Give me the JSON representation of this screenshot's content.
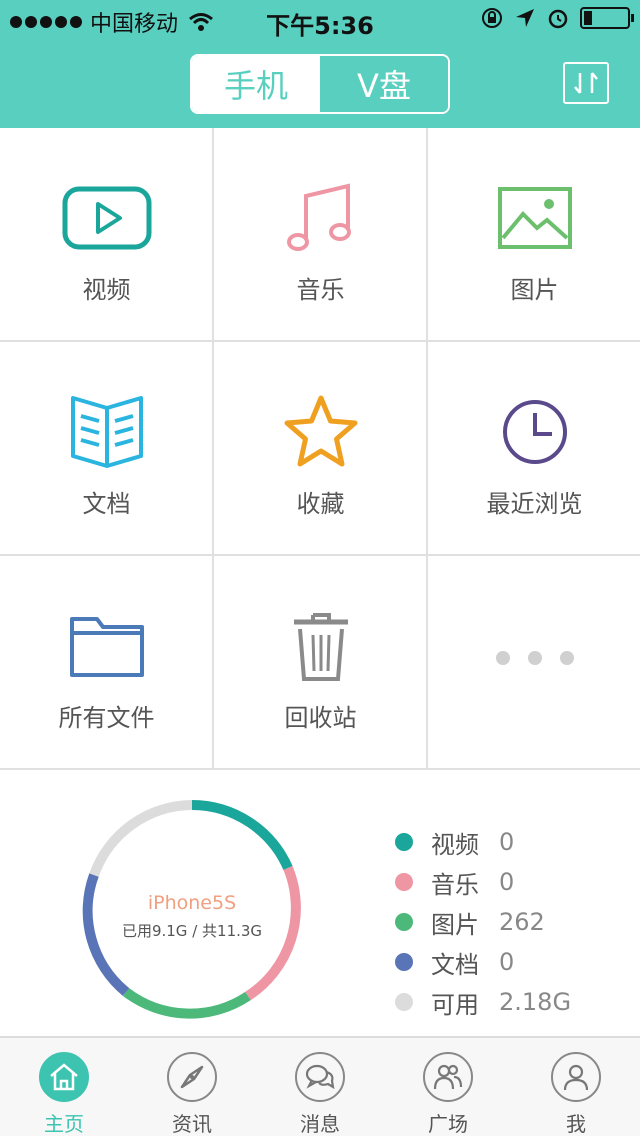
{
  "status_bar": {
    "carrier": "中国移动",
    "time": "下午5:36"
  },
  "header": {
    "segments": [
      "手机",
      "V盘"
    ],
    "active_segment": "手机",
    "transfer_icon": "transfer-icon"
  },
  "grid": {
    "items": [
      {
        "label": "视频",
        "icon": "video-icon",
        "color": "#1aa69a"
      },
      {
        "label": "音乐",
        "icon": "music-icon",
        "color": "#ef96a4"
      },
      {
        "label": "图片",
        "icon": "image-icon",
        "color": "#6cbf6c"
      },
      {
        "label": "文档",
        "icon": "document-icon",
        "color": "#2ab4e0"
      },
      {
        "label": "收藏",
        "icon": "star-icon",
        "color": "#f0a020"
      },
      {
        "label": "最近浏览",
        "icon": "clock-icon",
        "color": "#5a4a8c"
      },
      {
        "label": "所有文件",
        "icon": "folder-icon",
        "color": "#4a7ab8"
      },
      {
        "label": "回收站",
        "icon": "trash-icon",
        "color": "#8a8a8a"
      },
      {
        "label": "",
        "icon": "more-icon",
        "color": "#d0d0d0"
      }
    ]
  },
  "storage": {
    "device": "iPhone5S",
    "usage_text": "已用9.1G / 共11.3G",
    "legend": [
      {
        "name": "视频",
        "value": "0",
        "color": "#1aa69a"
      },
      {
        "name": "音乐",
        "value": "0",
        "color": "#ef96a4"
      },
      {
        "name": "图片",
        "value": "262",
        "color": "#4cb87a"
      },
      {
        "name": "文档",
        "value": "0",
        "color": "#5a74b8"
      },
      {
        "name": "可用",
        "value": "2.18G",
        "color": "#dcdcdc"
      }
    ]
  },
  "tabbar": {
    "tabs": [
      {
        "label": "主页",
        "icon": "home-icon"
      },
      {
        "label": "资讯",
        "icon": "compass-icon"
      },
      {
        "label": "消息",
        "icon": "chat-icon"
      },
      {
        "label": "广场",
        "icon": "users-icon"
      },
      {
        "label": "我",
        "icon": "person-icon"
      }
    ],
    "active": "主页"
  }
}
